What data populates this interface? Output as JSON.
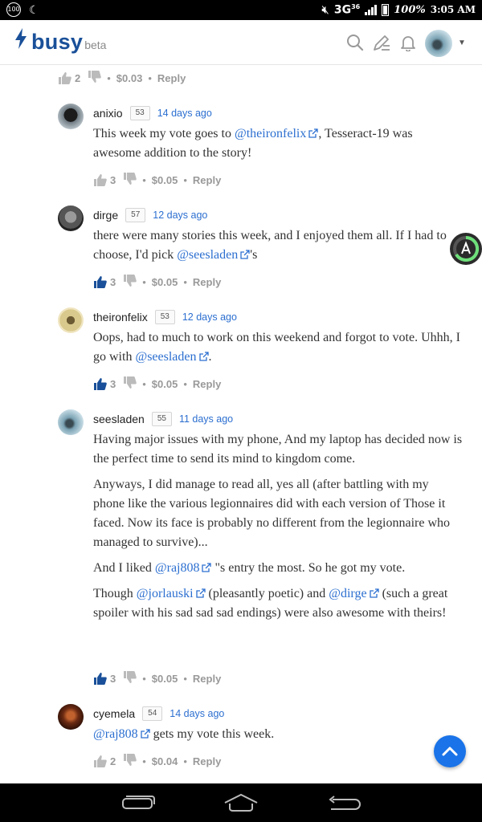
{
  "status_bar": {
    "badge": "100",
    "network": "3G",
    "network_sub": "36",
    "battery": "100%",
    "time": "3:05 AM"
  },
  "header": {
    "app_name": "busy",
    "app_badge": "beta",
    "icons": [
      "search-icon",
      "write-icon",
      "bell-icon",
      "avatar",
      "caret-down-icon"
    ]
  },
  "top_meta": {
    "votes": "2",
    "payout": "$0.03",
    "reply": "Reply"
  },
  "comments": [
    {
      "author": "anixio",
      "reputation": "53",
      "time": "14 days ago",
      "paragraphs": [
        {
          "pre": "This week my vote goes to ",
          "mention": "@theironfelix",
          "post": ", Tesseract-19 was awesome addition to the story!"
        }
      ],
      "votes": "3",
      "voted": false,
      "payout": "$0.05",
      "reply": "Reply"
    },
    {
      "author": "dirge",
      "reputation": "57",
      "time": "12 days ago",
      "paragraphs": [
        {
          "pre": "there were many stories this week, and I enjoyed them all. If I had to choose, I'd pick ",
          "mention": "@seesladen",
          "post": "'s"
        }
      ],
      "votes": "3",
      "voted": true,
      "payout": "$0.05",
      "reply": "Reply"
    },
    {
      "author": "theironfelix",
      "reputation": "53",
      "time": "12 days ago",
      "paragraphs": [
        {
          "pre": "Oops, had to much to work on this weekend and forgot to vote. Uhhh, I go with ",
          "mention": "@seesladen",
          "post": "."
        }
      ],
      "votes": "3",
      "voted": true,
      "payout": "$0.05",
      "reply": "Reply"
    },
    {
      "author": "seesladen",
      "reputation": "55",
      "time": "11 days ago",
      "paragraphs": [
        {
          "text": "Having major issues with my phone, And my laptop has decided now is the perfect time to send its mind to kingdom come."
        },
        {
          "text": "Anyways, I did manage to read all, yes all (after battling with my phone like the various legionnaires did with each version of Those it faced. Now its face is probably no different from the legionnaire who managed to survive)..."
        },
        {
          "pre": "And I liked ",
          "mention": "@raj808",
          "post": " \"s entry the most. So he got my vote."
        },
        {
          "pre": "Though ",
          "mention": "@jorlauski",
          "mid": " (pleasantly poetic) and ",
          "mention2": "@dirge",
          "post": " (such a great spoiler with his sad sad sad endings) were also awesome with theirs!"
        }
      ],
      "votes": "3",
      "voted": true,
      "payout": "$0.05",
      "reply": "Reply"
    },
    {
      "author": "cyemela",
      "reputation": "54",
      "time": "14 days ago",
      "paragraphs": [
        {
          "pre": "",
          "mention": "@raj808",
          "post": " gets my vote this week."
        }
      ],
      "votes": "2",
      "voted": false,
      "payout": "$0.04",
      "reply": "Reply"
    }
  ],
  "colors": {
    "brand": "#1a5099",
    "link": "#2c6fd0",
    "fab": "#1a73e8"
  }
}
